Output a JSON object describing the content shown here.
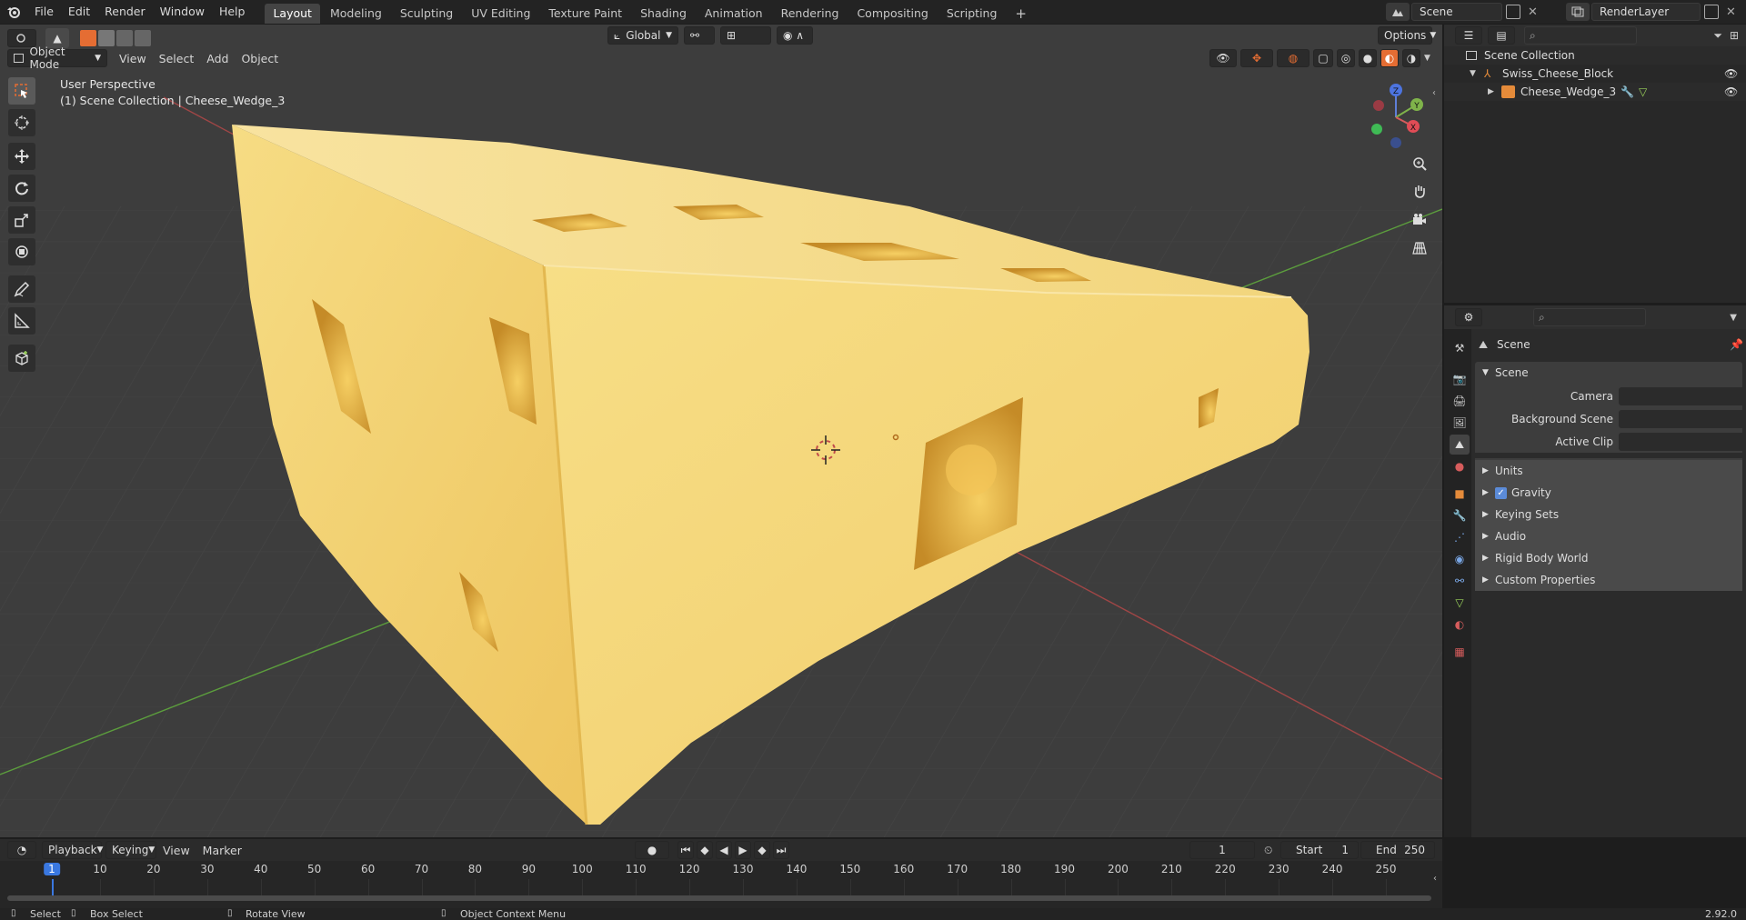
{
  "topbar": {
    "menus": [
      "File",
      "Edit",
      "Render",
      "Window",
      "Help"
    ],
    "workspaces": [
      "Layout",
      "Modeling",
      "Sculpting",
      "UV Editing",
      "Texture Paint",
      "Shading",
      "Animation",
      "Rendering",
      "Compositing",
      "Scripting"
    ],
    "active_workspace": "Layout",
    "add_label": "+",
    "scene_name": "Scene",
    "view_layer_name": "RenderLayer"
  },
  "viewport": {
    "mode_label": "Object Mode",
    "menus": [
      "View",
      "Select",
      "Add",
      "Object"
    ],
    "orientation_label": "Global",
    "options_label": "Options",
    "overlay_line1": "User Perspective",
    "overlay_line2": "(1) Scene Collection | Cheese_Wedge_3",
    "gizmo": {
      "x": "X",
      "y": "Y",
      "z": "Z"
    },
    "tools": [
      "select-box-tool",
      "cursor-tool",
      "move-tool",
      "rotate-tool",
      "scale-tool",
      "transform-tool",
      "annotate-tool",
      "measure-tool",
      "add-cube-tool"
    ],
    "colors": {
      "cheese": "#f2d472",
      "cheese_shadow": "#d9a83e",
      "background": "#3d3d3d",
      "x_axis": "#c24b4b",
      "y_axis": "#5c9e3d"
    }
  },
  "outliner": {
    "search_placeholder": "",
    "root": "Scene Collection",
    "collection": "Swiss_Cheese_Block",
    "object": "Cheese_Wedge_3"
  },
  "properties": {
    "header_title": "Scene",
    "panel_title": "Scene",
    "fields": [
      {
        "label": "Camera",
        "value": ""
      },
      {
        "label": "Background Scene",
        "value": ""
      },
      {
        "label": "Active Clip",
        "value": ""
      }
    ],
    "subpanels": [
      "Units",
      "Gravity",
      "Keying Sets",
      "Audio",
      "Rigid Body World",
      "Custom Properties"
    ],
    "gravity_checked": true
  },
  "timeline": {
    "menus": [
      "Playback",
      "Keying",
      "View",
      "Marker"
    ],
    "current_frame": "1",
    "start_label": "Start",
    "start_value": "1",
    "end_label": "End",
    "end_value": "250",
    "ticks": [
      "1",
      "10",
      "20",
      "30",
      "40",
      "50",
      "60",
      "70",
      "80",
      "90",
      "100",
      "110",
      "120",
      "130",
      "140",
      "150",
      "160",
      "170",
      "180",
      "190",
      "200",
      "210",
      "220",
      "230",
      "240",
      "250"
    ]
  },
  "statusbar": {
    "select": "Select",
    "box_select": "Box Select",
    "rotate_view": "Rotate View",
    "context_menu": "Object Context Menu",
    "version": "2.92.0"
  }
}
